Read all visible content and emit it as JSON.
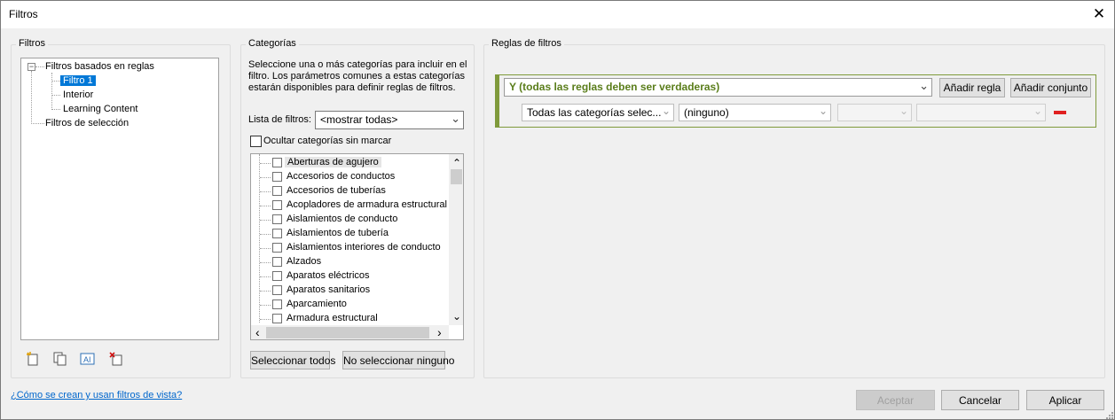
{
  "window": {
    "title": "Filtros",
    "close_glyph": "✕"
  },
  "filters_panel": {
    "label": "Filtros",
    "tree": {
      "rule_based": "Filtros basados en reglas",
      "children": [
        "Filtro 1",
        "Interior",
        "Learning Content"
      ],
      "selection": "Filtros de selección",
      "expander": "−"
    },
    "toolbar_icons": [
      "new-filter-icon",
      "duplicate-filter-icon",
      "rename-filter-icon",
      "delete-filter-icon"
    ]
  },
  "categories_panel": {
    "label": "Categorías",
    "description": "Seleccione una o más categorías para incluir en el filtro. Los parámetros comunes a estas categorías estarán disponibles para definir reglas de filtros.",
    "filter_list_label": "Lista de filtros:",
    "filter_list_value": "<mostrar todas>",
    "hide_unchecked_label": "Ocultar categorías sin marcar",
    "items": [
      "Aberturas de agujero",
      "Accesorios de conductos",
      "Accesorios de tuberías",
      "Acopladores de armadura estructural",
      "Aislamientos de conducto",
      "Aislamientos de tubería",
      "Aislamientos interiores de conducto",
      "Alzados",
      "Aparatos eléctricos",
      "Aparatos sanitarios",
      "Aparcamiento",
      "Armadura estructural"
    ],
    "select_all": "Seleccionar todos",
    "select_none": "No seleccionar ninguno"
  },
  "rules_panel": {
    "label": "Reglas de filtros",
    "condition": "Y (todas las reglas deben ser verdaderas)",
    "add_rule": "Añadir regla",
    "add_set": "Añadir conjunto",
    "category_value": "Todas las categorías selec...",
    "parameter_value": "(ninguno)",
    "condition_color": "#5a7d1a"
  },
  "footer": {
    "help_link": "¿Cómo se crean y usan filtros de vista?",
    "ok": "Aceptar",
    "cancel": "Cancelar",
    "apply": "Aplicar"
  },
  "glyphs": {
    "down": "⌄",
    "up": "⌃",
    "left": "‹",
    "right": "›"
  }
}
